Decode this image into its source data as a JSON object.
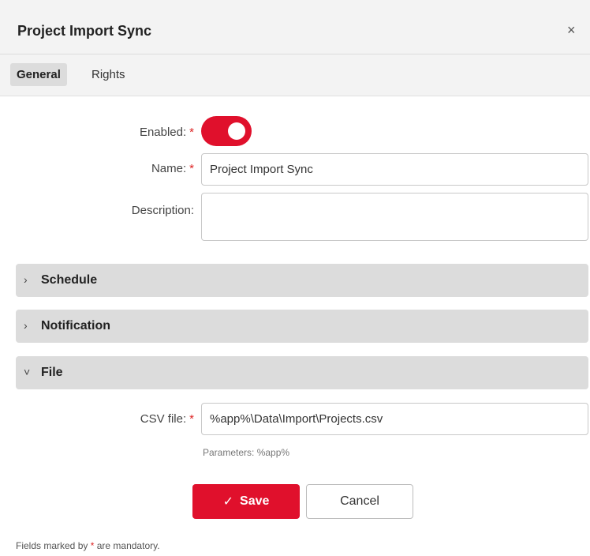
{
  "dialog": {
    "title": "Project Import Sync",
    "close_glyph": "×"
  },
  "tabs": [
    {
      "label": "General",
      "active": true
    },
    {
      "label": "Rights",
      "active": false
    }
  ],
  "form": {
    "enabled_label": "Enabled:",
    "enabled_value": true,
    "name_label": "Name:",
    "name_value": "Project Import Sync",
    "description_label": "Description:",
    "description_value": "",
    "required_mark": "*"
  },
  "sections": {
    "schedule": {
      "label": "Schedule",
      "chevron": "›",
      "expanded": false
    },
    "notification": {
      "label": "Notification",
      "chevron": "›",
      "expanded": false
    },
    "file": {
      "label": "File",
      "chevron": "˅",
      "expanded": true
    }
  },
  "file": {
    "csv_label": "CSV file:",
    "csv_value": "%app%\\Data\\Import\\Projects.csv",
    "hint": "Parameters: %app%"
  },
  "buttons": {
    "save_icon": "✓",
    "save_label": "Save",
    "cancel_label": "Cancel"
  },
  "footer": {
    "prefix": "Fields marked by",
    "mark": "*",
    "suffix": "are mandatory."
  },
  "colors": {
    "accent": "#e0102c",
    "section_bg": "#dcdcdc",
    "header_bg": "#f3f3f3"
  }
}
